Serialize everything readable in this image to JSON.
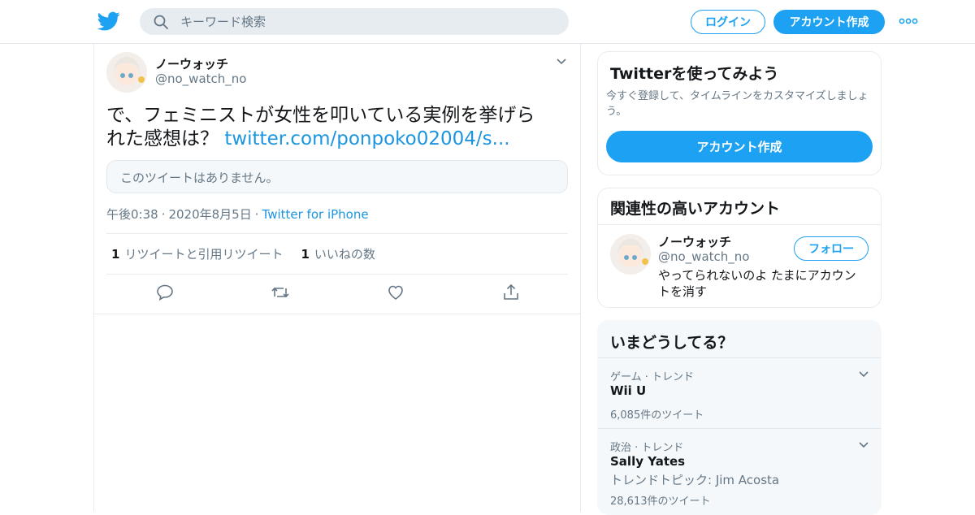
{
  "header": {
    "search_placeholder": "キーワード検索",
    "login_label": "ログイン",
    "signup_label": "アカウント作成",
    "colors": {
      "brand": "#1da1f2",
      "search_bg": "#e6ecf0"
    }
  },
  "tweet": {
    "display_name": "ノーウォッチ",
    "handle": "@no_watch_no",
    "text_line1": "で、フェミニストが女性を叩いている実例を挙げら",
    "text_line2": "れた感想は？",
    "link_text": "twitter.com/ponpoko02004/s...",
    "quote_unavailable": "このツイートはありません。",
    "time": "午後0:38",
    "date": "2020年8月5日",
    "separator": "·",
    "source": "Twitter for iPhone",
    "retweet_count": "1",
    "retweet_label": "リツイートと引用リツイート",
    "like_count": "1",
    "like_label": "いいねの数",
    "icons": [
      "reply-icon",
      "retweet-icon",
      "like-icon",
      "share-icon"
    ]
  },
  "sidebar": {
    "try_card": {
      "title": "Twitterを使ってみよう",
      "description": "今すぐ登録して、タイムラインをカスタマイズしましょう。",
      "button": "アカウント作成"
    },
    "related_card": {
      "title": "関連性の高いアカウント",
      "name": "ノーウォッチ",
      "handle": "@no_watch_no",
      "bio": "やってられないのよ たまにアカウントを消す",
      "follow_button": "フォロー"
    },
    "trends_card": {
      "title": "いまどうしてる？",
      "items": [
        {
          "category": "ゲーム · トレンド",
          "name": "Wii U",
          "topic": "",
          "count": "6,085件のツイート"
        },
        {
          "category": "政治 · トレンド",
          "name": "Sally Yates",
          "topic": "トレンドトピック: Jim Acosta",
          "count": "28,613件のツイート"
        }
      ]
    }
  }
}
